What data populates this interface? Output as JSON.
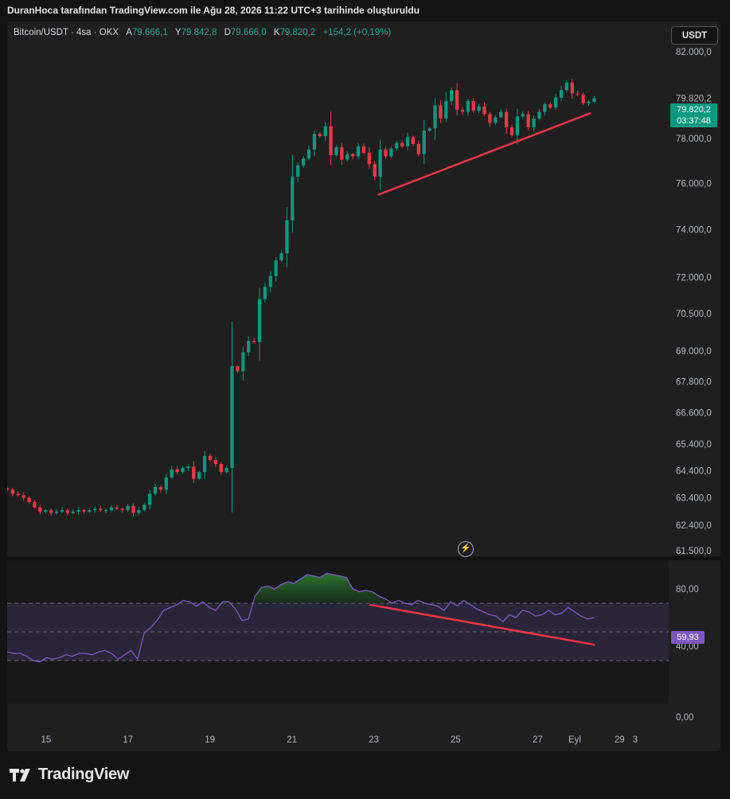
{
  "header": {
    "text": "DuranHoca tarafından TradingView.com ile Ağu 28, 2026 11:22 UTC+3 tarihinde oluşturuldu"
  },
  "legend": {
    "symbol": "Bitcoin/USDT · 4sa · OKX",
    "open_label": "A",
    "open": "79.666,1",
    "high_label": "Y",
    "high": "79.842,8",
    "low_label": "D",
    "low": "79.666,0",
    "close_label": "K",
    "close": "79.820,2",
    "change": "+154,2 (+0,19%)"
  },
  "currency_button": "USDT",
  "price_tag": {
    "price": "79.820,2",
    "countdown": "03:37:48"
  },
  "rsi_tag": "59,93",
  "colors": {
    "up": "#089981",
    "down": "#f23645",
    "rsi_line": "#7e57c2",
    "trendline": "#f23645",
    "rsi_band": "#2a2538"
  },
  "footer": {
    "logo_icon": "tradingview-logo-icon",
    "brand": "TradingView"
  },
  "chart_data": [
    {
      "type": "candlestick",
      "title": "",
      "price_axis_ticks": [
        "82.000,0",
        "79.820,2",
        "78.000,0",
        "76.000,0",
        "74.000,0",
        "72.000,0",
        "70.500,0",
        "69.000,0",
        "67.800,0",
        "66.600,0",
        "65.400,0",
        "64.400,0",
        "63.400,0",
        "62.400,0",
        "61.500,0"
      ],
      "time_axis_ticks": [
        "15",
        "17",
        "19",
        "21",
        "23",
        "25",
        "27",
        "29",
        "Eyl",
        "3"
      ],
      "scale": "log",
      "ylim": [
        61300,
        82600
      ],
      "xlim_days": [
        14.05,
        30.2
      ],
      "closes": [
        63700,
        63550,
        63500,
        63400,
        63250,
        63050,
        62900,
        62950,
        62850,
        62900,
        62950,
        62850,
        62900,
        62950,
        62900,
        62950,
        63000,
        62950,
        62950,
        63050,
        63000,
        62950,
        63100,
        62850,
        62950,
        63150,
        63550,
        63800,
        63700,
        64150,
        64450,
        64350,
        64500,
        64550,
        64100,
        64350,
        64950,
        64800,
        64650,
        64350,
        64500,
        68400,
        68200,
        68950,
        69400,
        69350,
        71100,
        71600,
        72050,
        72700,
        73000,
        74400,
        76300,
        76800,
        77100,
        77500,
        78200,
        78100,
        78550,
        77250,
        77600,
        77050,
        77300,
        77200,
        77650,
        77350,
        76850,
        76300,
        77500,
        77200,
        77550,
        77800,
        77650,
        78050,
        77750,
        77300,
        78350,
        78450,
        79500,
        78900,
        79700,
        80200,
        79300,
        79200,
        79700,
        79250,
        79450,
        79100,
        78700,
        78950,
        79200,
        78500,
        78150,
        79000,
        79100,
        78500,
        78900,
        79200,
        79550,
        79400,
        79850,
        80200,
        80550,
        80050,
        80000,
        79600,
        79666,
        79820
      ],
      "trendline": {
        "from": {
          "day": 23.1,
          "price": 75500
        },
        "to": {
          "day": 28.3,
          "price": 79150
        }
      }
    },
    {
      "type": "line",
      "title": "",
      "axis_ticks": [
        "80,00",
        "40,00",
        "0,00"
      ],
      "ylim": [
        0,
        100
      ],
      "upper_band": 70,
      "middle_band": 50,
      "lower_band": 30,
      "values": [
        36,
        35,
        35,
        33,
        30,
        29,
        32,
        31,
        32,
        34,
        33,
        35,
        35,
        34,
        36,
        37,
        35,
        31,
        34,
        37,
        31,
        49,
        53,
        58,
        65,
        67,
        69,
        72,
        71,
        68,
        71,
        67,
        65,
        71,
        71,
        66,
        58,
        59,
        75,
        81,
        82,
        80,
        83,
        85,
        84,
        87,
        90,
        89,
        88,
        91,
        90,
        89,
        88,
        80,
        78,
        79,
        78,
        75,
        73,
        70,
        72,
        70,
        69,
        72,
        70,
        69,
        68,
        65,
        71,
        68,
        72,
        69,
        66,
        64,
        62,
        61,
        57,
        62,
        60,
        65,
        64,
        61,
        62,
        65,
        62,
        63,
        67,
        64,
        61,
        59,
        60
      ],
      "trendline": {
        "from": {
          "day": 22.9,
          "value": 69
        },
        "to": {
          "day": 28.4,
          "value": 41
        }
      }
    }
  ]
}
